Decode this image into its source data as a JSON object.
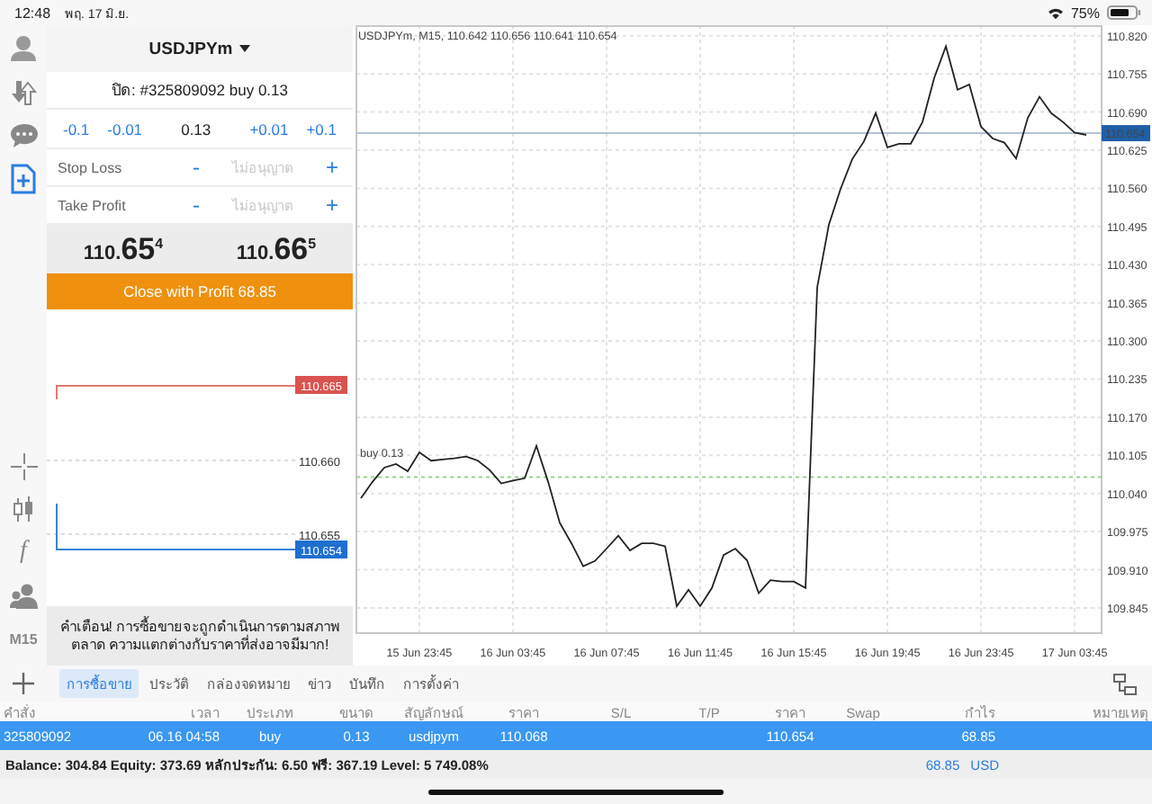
{
  "status_bar": {
    "time": "12:48",
    "date": "พฤ. 17 มิ.ย.",
    "battery": "75%"
  },
  "rail": {
    "items": [
      {
        "kind": "account",
        "selected": false
      },
      {
        "kind": "trade",
        "selected": false
      },
      {
        "kind": "chat",
        "selected": false
      },
      {
        "kind": "new_order",
        "selected": true
      }
    ],
    "tools": [
      {
        "kind": "crosshair"
      },
      {
        "kind": "chart_type"
      },
      {
        "kind": "indicators",
        "label": "f"
      },
      {
        "kind": "objects"
      },
      {
        "kind": "timeframe",
        "label": "M15"
      }
    ]
  },
  "order_panel": {
    "symbol": "USDJPYm",
    "title": "ปิด: #325809092 buy 0.13",
    "volume": {
      "down": [
        "-0.1",
        "-0.01"
      ],
      "value": "0.13",
      "up": [
        "+0.01",
        "+0.1"
      ]
    },
    "stops": [
      {
        "label": "Stop Loss",
        "minus": "-",
        "placeholder": "ไม่อนุญาต",
        "plus": "+"
      },
      {
        "label": "Take Profit",
        "minus": "-",
        "placeholder": "ไม่อนุญาต",
        "plus": "+"
      }
    ],
    "bid": {
      "prefix": "110.",
      "big": "65",
      "pip": "4"
    },
    "ask": {
      "prefix": "110.",
      "big": "66",
      "pip": "5"
    },
    "button": "Close with Profit 68.85",
    "mini_chart": {
      "ask_label": "110.665",
      "levels": [
        "110.660",
        "110.655"
      ],
      "bid_label": "110.654"
    },
    "warning": "คำเตือน! การซื้อขายจะถูกดำเนินการตามสภาพตลาด ความแตกต่างกับราคาที่ส่งอาจมีมาก!"
  },
  "chart": {
    "chart_data": {
      "type": "line",
      "title": "USDJPYm, M15, 110.642 110.656 110.641 110.654",
      "categories": [
        null,
        null,
        null,
        null,
        null,
        "15 Jun 23:45",
        null,
        null,
        null,
        null,
        null,
        null,
        null,
        "16 Jun 03:45",
        null,
        null,
        null,
        null,
        null,
        null,
        null,
        "16 Jun 07:45",
        null,
        null,
        null,
        null,
        null,
        null,
        null,
        "16 Jun 11:45",
        null,
        null,
        null,
        null,
        null,
        null,
        null,
        "16 Jun 15:45",
        null,
        null,
        null,
        null,
        null,
        null,
        null,
        "16 Jun 19:45",
        null,
        null,
        null,
        null,
        null,
        null,
        null,
        "16 Jun 23:45",
        null,
        null,
        null,
        null,
        null,
        null,
        null,
        "17 Jun 03:45",
        null
      ],
      "series": [
        {
          "color": "#222222",
          "values": [
            110.032,
            110.06,
            110.084,
            110.09,
            110.078,
            110.11,
            110.096,
            110.098,
            110.1,
            110.103,
            110.096,
            110.08,
            110.057,
            110.062,
            110.066,
            110.121,
            110.06,
            109.99,
            109.955,
            109.916,
            109.925,
            109.946,
            109.968,
            109.943,
            109.955,
            109.955,
            109.95,
            109.848,
            109.876,
            109.848,
            109.879,
            109.935,
            109.946,
            109.926,
            109.87,
            109.892,
            109.89,
            109.89,
            109.879,
            110.391,
            110.498,
            110.559,
            110.61,
            110.64,
            110.688,
            110.63,
            110.636,
            110.636,
            110.673,
            110.748,
            110.802,
            110.728,
            110.737,
            110.665,
            110.645,
            110.638,
            110.611,
            110.68,
            110.716,
            110.688,
            110.673,
            110.655,
            110.651
          ]
        }
      ],
      "ylim": [
        109.802,
        110.838
      ],
      "grid": true,
      "yticks": [
        {
          "value": 110.82,
          "label": "110.820"
        },
        {
          "value": 110.755,
          "label": "110.755"
        },
        {
          "value": 110.69,
          "label": "110.690"
        },
        {
          "value": 110.625,
          "label": "110.625"
        },
        {
          "value": 110.56,
          "label": "110.560"
        },
        {
          "value": 110.495,
          "label": "110.495"
        },
        {
          "value": 110.43,
          "label": "110.430"
        },
        {
          "value": 110.365,
          "label": "110.365"
        },
        {
          "value": 110.3,
          "label": "110.300"
        },
        {
          "value": 110.235,
          "label": "110.235"
        },
        {
          "value": 110.17,
          "label": "110.170"
        },
        {
          "value": 110.105,
          "label": "110.105"
        },
        {
          "value": 110.04,
          "label": "110.040"
        },
        {
          "value": 109.975,
          "label": "109.975"
        },
        {
          "value": 109.91,
          "label": "109.910"
        },
        {
          "value": 109.845,
          "label": "109.845"
        }
      ],
      "ref_lines": [
        {
          "axis": "y",
          "value": 110.068,
          "label": "buy 0.13"
        },
        {
          "axis": "y",
          "value": 110.654,
          "label": "110.654"
        }
      ]
    }
  },
  "tabs": [
    {
      "label": "การซื้อขาย",
      "selected": true
    },
    {
      "label": "ประวัติ",
      "selected": false
    },
    {
      "label": "กล่องจดหมาย",
      "selected": false
    },
    {
      "label": "ข่าว",
      "selected": false
    },
    {
      "label": "บันทึก",
      "selected": false
    },
    {
      "label": "การตั้งค่า",
      "selected": false
    }
  ],
  "table": {
    "columns": [
      "คำสั่ง",
      "เวลา",
      "ประเภท",
      "ขนาด",
      "สัญลักษณ์",
      "ราคา",
      "S/L",
      "T/P",
      "ราคา",
      "Swap",
      "กำไร",
      "หมายเหตุ"
    ],
    "rows": [
      {
        "order": "325809092",
        "time": "06.16 04:58",
        "type": "buy",
        "size": "0.13",
        "symbol": "usdjpym",
        "open_price": "110.068",
        "current_price": "110.654",
        "profit": "68.85",
        "selected": true
      }
    ]
  },
  "footer": {
    "summary": "Balance: 304.84 Equity: 373.69 หลักประกัน: 6.50 ฟรี: 367.19 Level: 5 749.08%",
    "profit": "68.85",
    "currency": "USD"
  }
}
